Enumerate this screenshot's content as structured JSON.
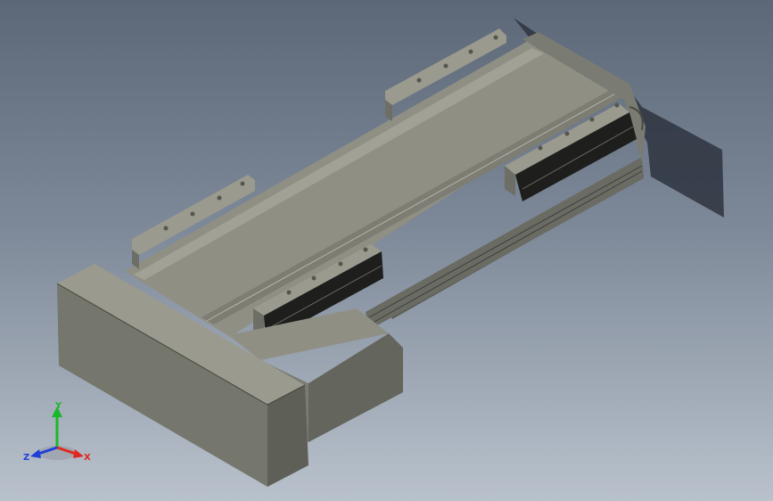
{
  "view": {
    "background_top": "#5c6878",
    "background_bottom": "#b9c2cc",
    "part_color": "#8e8e82",
    "shadow_color": "#2e3440"
  },
  "triad": {
    "x_label": "X",
    "y_label": "Y",
    "z_label": "Z",
    "x_color": "#e0281e",
    "y_color": "#19b82a",
    "z_color": "#1f3fd8"
  }
}
